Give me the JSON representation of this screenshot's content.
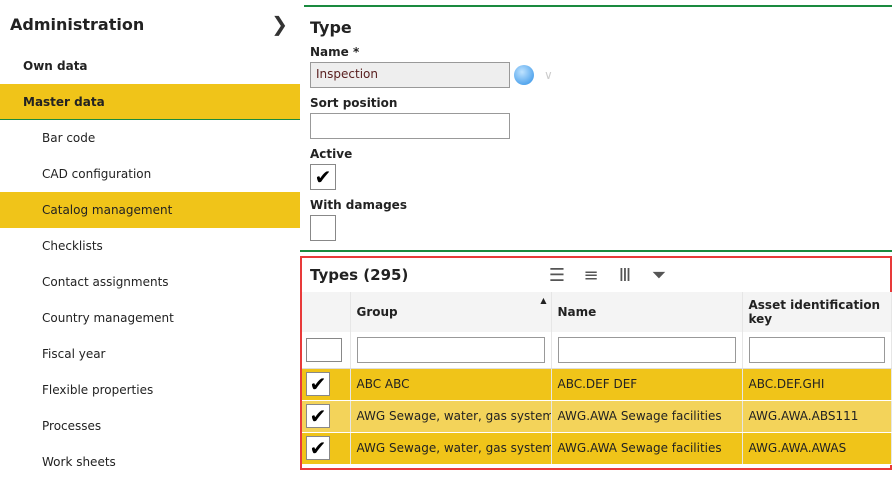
{
  "sidebar": {
    "title": "Administration",
    "level1": [
      {
        "label": "Own data"
      },
      {
        "label": "Master data"
      }
    ],
    "items": [
      {
        "label": "Bar code"
      },
      {
        "label": "CAD configuration"
      },
      {
        "label": "Catalog management"
      },
      {
        "label": "Checklists"
      },
      {
        "label": "Contact assignments"
      },
      {
        "label": "Country management"
      },
      {
        "label": "Fiscal year"
      },
      {
        "label": "Flexible properties"
      },
      {
        "label": "Processes"
      },
      {
        "label": "Work sheets"
      }
    ]
  },
  "form": {
    "title": "Type",
    "name_label": "Name *",
    "name_value": "Inspection",
    "sort_label": "Sort position",
    "sort_value": "",
    "active_label": "Active",
    "active": true,
    "damages_label": "With damages",
    "damages": false
  },
  "grid": {
    "title": "Types (295)",
    "columns": [
      "Group",
      "Name",
      "Asset identification key"
    ],
    "rows": [
      {
        "checked": true,
        "group": "ABC ABC",
        "name": "ABC.DEF DEF",
        "key": "ABC.DEF.GHI"
      },
      {
        "checked": true,
        "group": "AWG Sewage, water, gas systems",
        "name": "AWG.AWA Sewage facilities",
        "key": "AWG.AWA.ABS111"
      },
      {
        "checked": true,
        "group": "AWG Sewage, water, gas systems",
        "name": "AWG.AWA Sewage facilities",
        "key": "AWG.AWA.AWAS"
      }
    ]
  },
  "colors": {
    "highlight": "#f0c419",
    "accent_line": "#1a8a3f",
    "grid_border": "#e83a3a"
  }
}
